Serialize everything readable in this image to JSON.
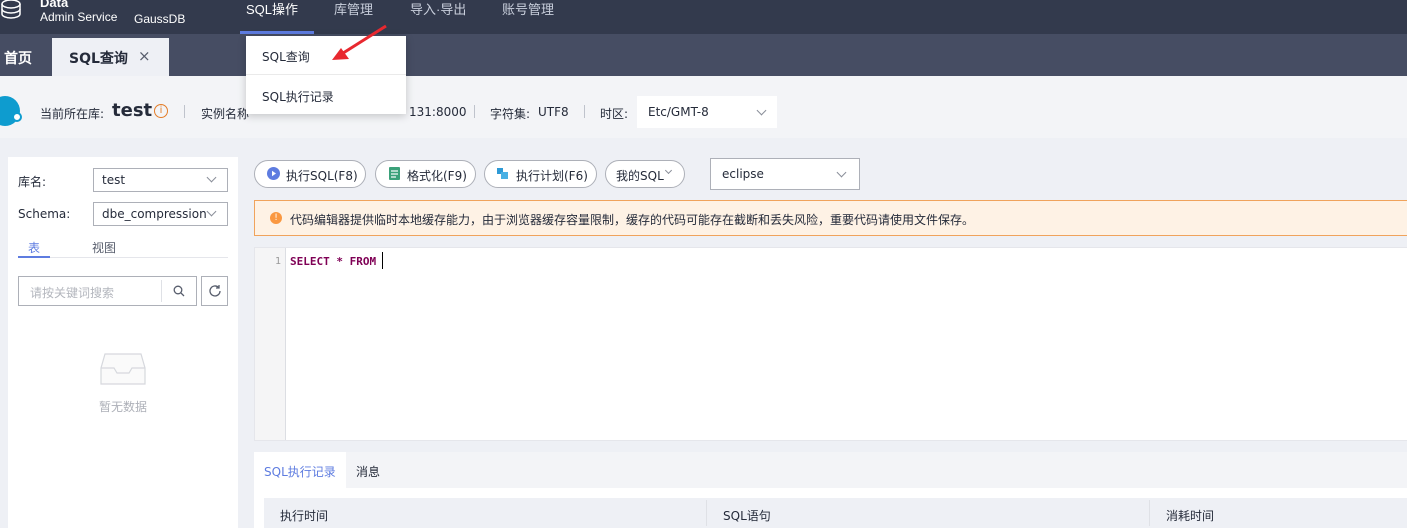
{
  "header": {
    "logo_line1": "Data",
    "logo_line2": "Admin Service",
    "product": "GaussDB",
    "nav": [
      {
        "label": "SQL操作",
        "active": true
      },
      {
        "label": "库管理",
        "active": false
      },
      {
        "label": "导入·导出",
        "active": false
      },
      {
        "label": "账号管理",
        "active": false
      }
    ]
  },
  "tabs": {
    "home": "首页",
    "current": "SQL查询",
    "close_symbol": "×"
  },
  "dropdown": {
    "items": [
      "SQL查询",
      "SQL执行记录"
    ]
  },
  "infobar": {
    "current_db_label": "当前所在库:",
    "current_db": "test",
    "instance_label": "实例名称",
    "address_fragment": "131:8000",
    "charset_label": "字符集:",
    "charset": "UTF8",
    "timezone_label": "时区:",
    "timezone": "Etc/GMT-8"
  },
  "left_panel": {
    "db_label": "库名:",
    "db_value": "test",
    "schema_label": "Schema:",
    "schema_value": "dbe_compression",
    "tab_table": "表",
    "tab_view": "视图",
    "search_placeholder": "请按关键词搜索",
    "empty_text": "暂无数据"
  },
  "toolbar": {
    "execute": "执行SQL(F8)",
    "format": "格式化(F9)",
    "plan": "执行计划(F6)",
    "my_sql": "我的SQL",
    "theme": "eclipse"
  },
  "notice": {
    "icon": "!",
    "text": "代码编辑器提供临时本地缓存能力，由于浏览器缓存容量限制，缓存的代码可能存在截断和丢失风险，重要代码请使用文件保存。"
  },
  "editor": {
    "line_number": "1",
    "code": "SELECT * FROM "
  },
  "results": {
    "tab_history": "SQL执行记录",
    "tab_messages": "消息",
    "columns": [
      "执行时间",
      "SQL语句",
      "消耗时间"
    ]
  },
  "colors": {
    "header_bg": "#333a4d",
    "tabbar_bg": "#464d63",
    "accent": "#5e7ce0",
    "warning": "#fa9841"
  }
}
